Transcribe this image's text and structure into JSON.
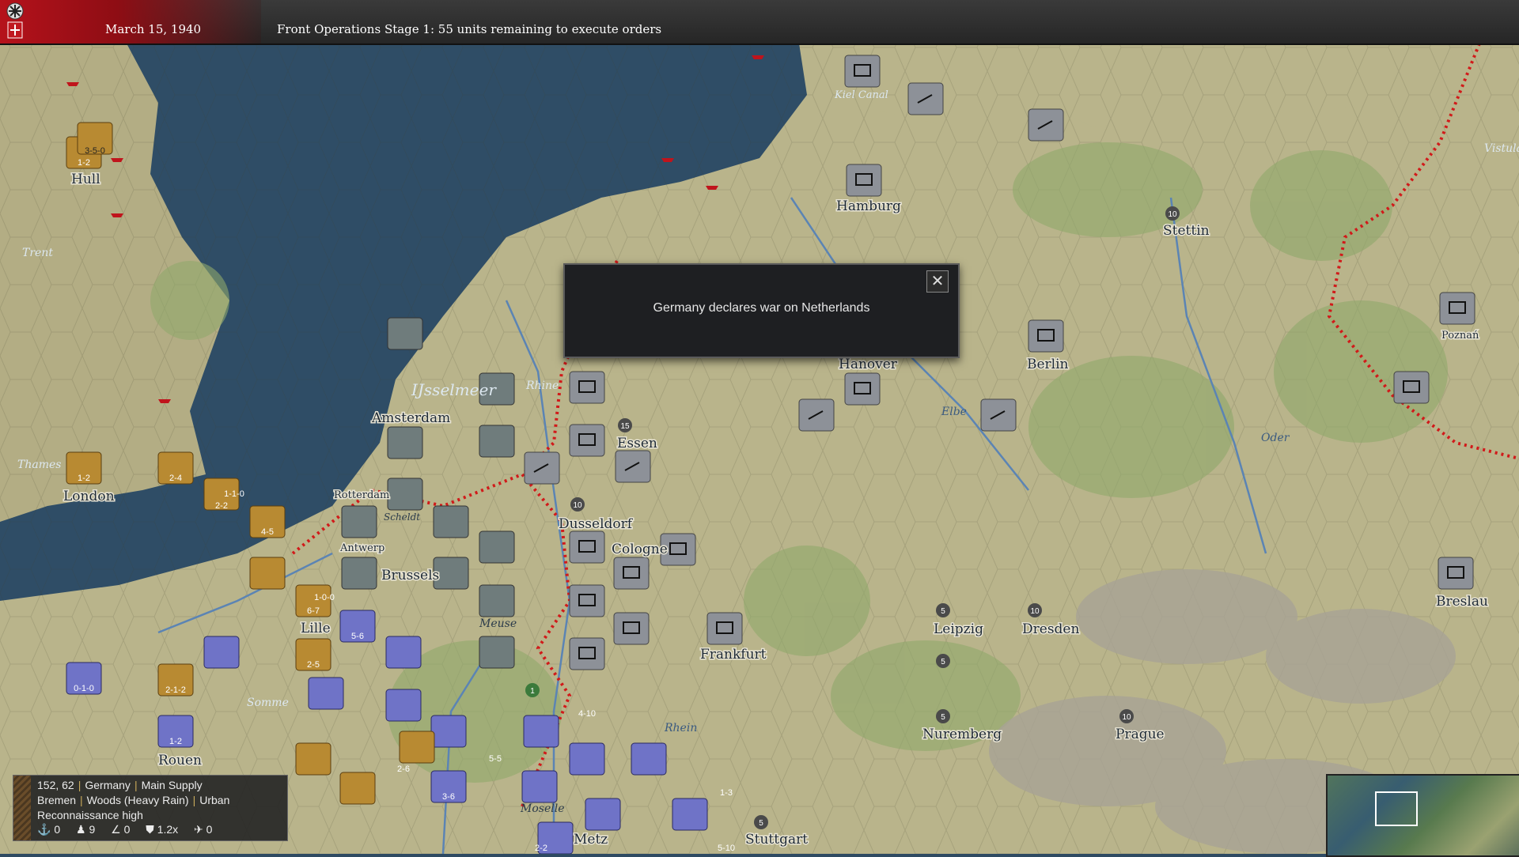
{
  "header": {
    "date": "March 15, 1940",
    "status": "Front Operations Stage 1: 55 units remaining to execute orders"
  },
  "dialog": {
    "message": "Germany declares war on Netherlands",
    "close_label": "✕"
  },
  "info": {
    "coords": "152, 62",
    "owner": "Germany",
    "supply": "Main Supply",
    "region": "Bremen",
    "terrain": "Woods (Heavy Rain)",
    "type": "Urban",
    "recon": "Reconnaissance high",
    "stats": [
      "0",
      "9",
      "0",
      "1.2x",
      "0"
    ]
  },
  "cities": [
    "Hull",
    "London",
    "Amsterdam",
    "Rotterdam",
    "Antwerp",
    "Brussels",
    "Lille",
    "Rouen",
    "Metz",
    "Essen",
    "Dusseldorf",
    "Cologne",
    "Frankfurt",
    "Stuttgart",
    "Hamburg",
    "Hanover",
    "Berlin",
    "Stettin",
    "Leipzig",
    "Dresden",
    "Nuremberg",
    "Prague",
    "Poznań",
    "Breslau"
  ],
  "rivers": [
    "Trent",
    "Thames",
    "Somme",
    "Meuse",
    "Moselle",
    "Rhine",
    "Rhein",
    "Elbe",
    "Oder",
    "Kiel Canal",
    "Scheldt",
    "Vistula",
    "IJsselmeer"
  ],
  "unit_labels": [
    "1-2",
    "2-4",
    "1-1-0",
    "2-2",
    "4-5",
    "6-7",
    "1-0-0",
    "5-6",
    "2-5",
    "2-1-2",
    "1-2",
    "0-1-0",
    "3-6",
    "4-10",
    "5-5",
    "2-6",
    "1-3",
    "5-10",
    "2-2",
    "3-5-0"
  ],
  "unit_counts": [
    "15",
    "10",
    "5",
    "1"
  ],
  "colors": {
    "germany": "#8d9198",
    "france": "#6f73c7",
    "britain": "#b88a32",
    "netherlands": "#6e7a7a",
    "sea": "#2e4a62",
    "land": "#b7b48a",
    "border": "#d11a1a"
  }
}
